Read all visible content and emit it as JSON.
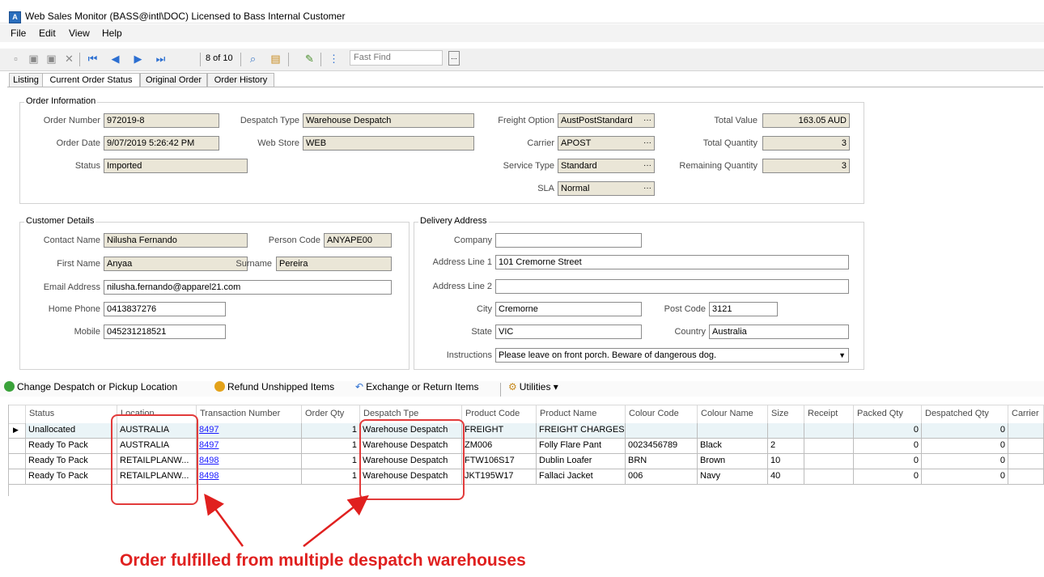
{
  "window": {
    "title": "Web Sales Monitor (BASS@intl\\DOC) Licensed to Bass Internal Customer",
    "icon": "app-icon"
  },
  "menu": [
    "File",
    "Edit",
    "View",
    "Help"
  ],
  "toolbar": {
    "page": "8 of 10",
    "fast_find_placeholder": "Fast Find",
    "fast_find_button": "..."
  },
  "tabs": [
    "Listing",
    "Current Order Status",
    "Original Order",
    "Order History"
  ],
  "order_info": {
    "title": "Order Information",
    "order_number_label": "Order Number",
    "order_number": "972019-8",
    "despatch_type_label": "Despatch Type",
    "despatch_type": "Warehouse Despatch",
    "freight_option_label": "Freight Option",
    "freight_option": "AustPostStandard",
    "total_value_label": "Total Value",
    "total_value": "163.05 AUD",
    "order_date_label": "Order Date",
    "order_date": "9/07/2019 5:26:42 PM",
    "web_store_label": "Web Store",
    "web_store": "WEB",
    "carrier_label": "Carrier",
    "carrier": "APOST",
    "total_quantity_label": "Total Quantity",
    "total_quantity": "3",
    "status_label": "Status",
    "status": "Imported",
    "service_type_label": "Service Type",
    "service_type": "Standard",
    "remaining_quantity_label": "Remaining Quantity",
    "remaining_quantity": "3",
    "sla_label": "SLA",
    "sla": "Normal"
  },
  "customer": {
    "title": "Customer Details",
    "contact_name_label": "Contact Name",
    "contact_name": "Nilusha Fernando",
    "person_code_label": "Person Code",
    "person_code": "ANYAPE00",
    "first_name_label": "First Name",
    "first_name": "Anyaa",
    "surname_label": "Surname",
    "surname": "Pereira",
    "email_label": "Email Address",
    "email": "nilusha.fernando@apparel21.com",
    "home_phone_label": "Home Phone",
    "home_phone": "0413837276",
    "mobile_label": "Mobile",
    "mobile": "045231218521"
  },
  "delivery": {
    "title": "Delivery Address",
    "company_label": "Company",
    "company": "",
    "address1_label": "Address Line 1",
    "address1": "101 Cremorne Street",
    "address2_label": "Address Line 2",
    "address2": "",
    "city_label": "City",
    "city": "Cremorne",
    "post_code_label": "Post Code",
    "post_code": "3121",
    "state_label": "State",
    "state": "VIC",
    "country_label": "Country",
    "country": "Australia",
    "instructions_label": "Instructions",
    "instructions": "Please leave on front porch. Beware of dangerous dog."
  },
  "actions": {
    "change_despatch": "Change Despatch or Pickup Location",
    "refund": "Refund Unshipped Items",
    "exchange": "Exchange or Return Items",
    "utilities": "Utilities ▾"
  },
  "grid": {
    "columns": [
      "Status",
      "Location",
      "Transaction Number",
      "Order Qty",
      "Despatch Tpe",
      "Product Code",
      "Product Name",
      "Colour Code",
      "Colour Name",
      "Size",
      "Receipt",
      "Packed Qty",
      "Despatched Qty",
      "Carrier"
    ],
    "rows": [
      [
        "Unallocated",
        "AUSTRALIA",
        "8497",
        "1",
        "Warehouse Despatch",
        "FREIGHT",
        "FREIGHT CHARGES",
        "",
        "",
        "",
        "",
        "0",
        "0",
        ""
      ],
      [
        "Ready To Pack",
        "AUSTRALIA",
        "8497",
        "1",
        "Warehouse Despatch",
        "ZM006",
        "Folly Flare Pant",
        "0023456789",
        "Black",
        "2",
        "",
        "0",
        "0",
        ""
      ],
      [
        "Ready To Pack",
        "RETAILPLANW...",
        "8498",
        "1",
        "Warehouse Despatch",
        "FTW106S17",
        "Dublin Loafer",
        "BRN",
        "Brown",
        "10",
        "",
        "0",
        "0",
        ""
      ],
      [
        "Ready To Pack",
        "RETAILPLANW...",
        "8498",
        "1",
        "Warehouse Despatch",
        "JKT195W17",
        "Fallaci Jacket",
        "006",
        "Navy",
        "40",
        "",
        "0",
        "0",
        ""
      ]
    ]
  },
  "annotation": "Order fulfilled from multiple despatch warehouses",
  "colors": {
    "annotation": "#e0201f",
    "readonly_field": "#eae6d7",
    "link": "#1a1aff"
  }
}
